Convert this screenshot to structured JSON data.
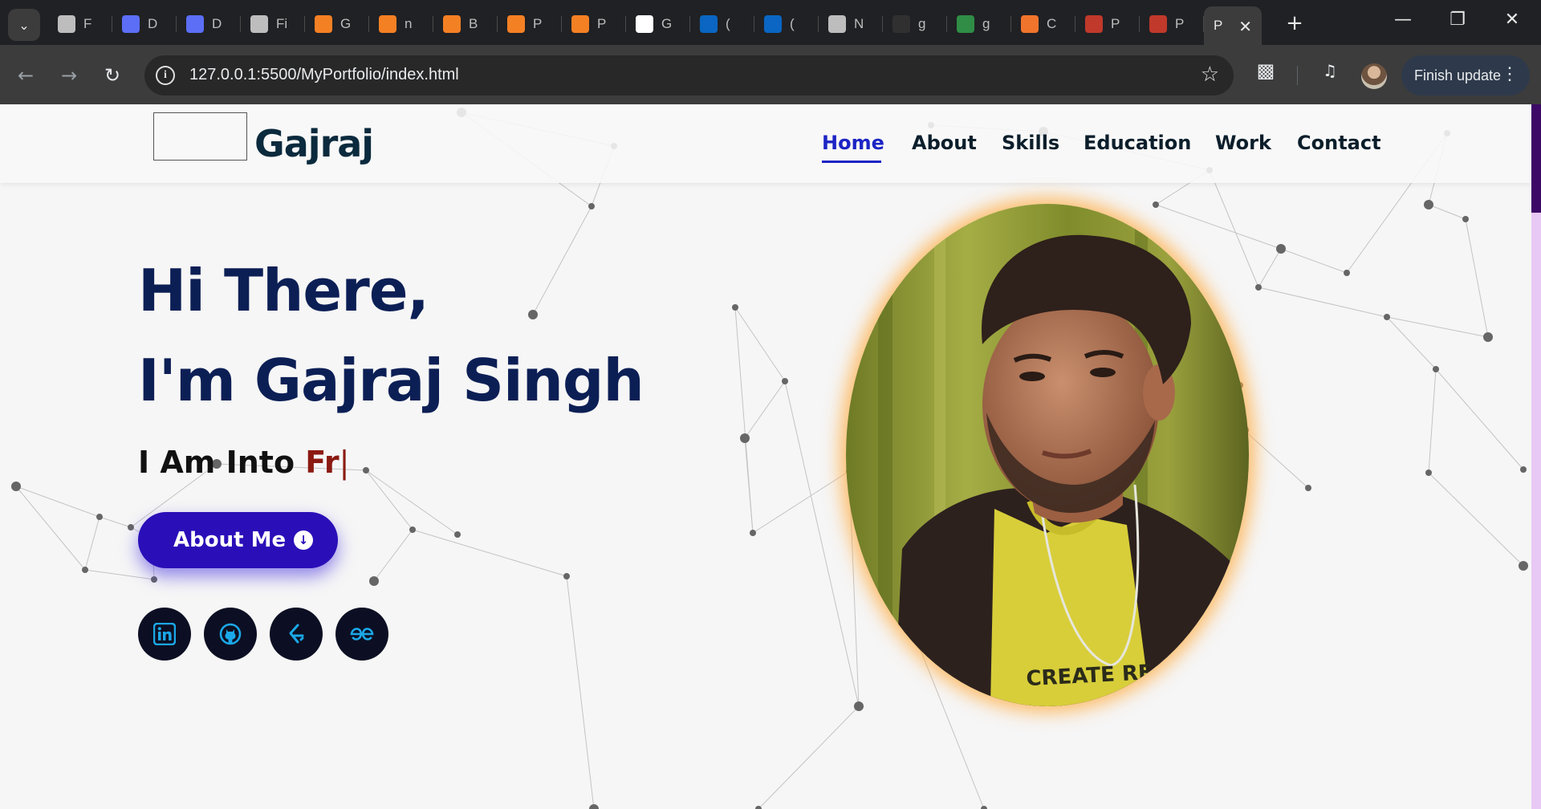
{
  "browser": {
    "tabs": [
      {
        "title": "F",
        "favicon": "infinity-icon",
        "color": "#bdbdbd"
      },
      {
        "title": "D",
        "favicon": "devto-bird-icon",
        "color": "#5b6ef5"
      },
      {
        "title": "D",
        "favicon": "devto-bird-icon",
        "color": "#5b6ef5"
      },
      {
        "title": "Fi",
        "favicon": "globe-icon",
        "color": "#bdbdbd"
      },
      {
        "title": "G",
        "favicon": "stackoverflow-icon",
        "color": "#f48024"
      },
      {
        "title": "n",
        "favicon": "stackoverflow-icon",
        "color": "#f48024"
      },
      {
        "title": "B",
        "favicon": "stackoverflow-icon",
        "color": "#f48024"
      },
      {
        "title": "P",
        "favicon": "stackoverflow-icon",
        "color": "#f48024"
      },
      {
        "title": "P",
        "favicon": "stackoverflow-icon",
        "color": "#f48024"
      },
      {
        "title": "G",
        "favicon": "github-icon",
        "color": "#ffffff"
      },
      {
        "title": "(",
        "favicon": "linkedin-icon",
        "color": "#0a66c2"
      },
      {
        "title": "(",
        "favicon": "linkedin-icon",
        "color": "#0a66c2"
      },
      {
        "title": "N",
        "favicon": "chrome-icon",
        "color": "#bdbdbd"
      },
      {
        "title": "g",
        "favicon": "github-icon",
        "color": "#303030"
      },
      {
        "title": "g",
        "favicon": "gfg-icon",
        "color": "#2f8d46"
      },
      {
        "title": "C",
        "favicon": "codepen-icon",
        "color": "#f0742c"
      },
      {
        "title": "P",
        "favicon": "avatar-icon",
        "color": "#c0392b"
      },
      {
        "title": "P",
        "favicon": "avatar-icon",
        "color": "#c0392b"
      }
    ],
    "active_tab": {
      "title": "P"
    },
    "url": "127.0.0.1:5500/MyPortfolio/index.html",
    "update_label": "Finish update"
  },
  "site": {
    "logo_text": "Gajraj",
    "nav": [
      "Home",
      "About",
      "Skills",
      "Education",
      "Work",
      "Contact"
    ],
    "active_nav": "Home"
  },
  "hero": {
    "line1": "Hi There,",
    "line2": "I'm Gajraj Singh",
    "subtitle_prefix": "I Am Into ",
    "typed_text": "Fr",
    "cursor": "|",
    "button_label": "About Me",
    "socials": [
      "linkedin-icon",
      "github-icon",
      "leetcode-icon",
      "geeksforgeeks-icon"
    ]
  },
  "colors": {
    "accent": "#2a0fb8",
    "heading": "#0c1f55",
    "typed": "#8b1a12",
    "nav_active": "#1c24c4",
    "social_icon": "#1ba8e8"
  }
}
